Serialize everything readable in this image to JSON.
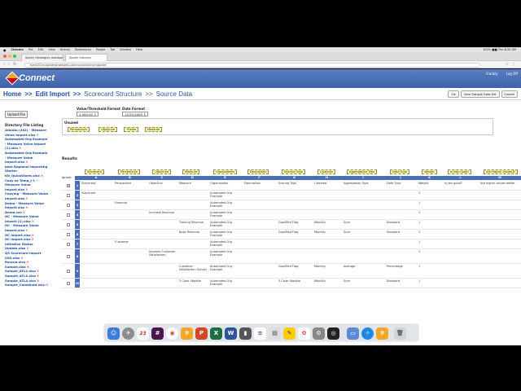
{
  "menubar": {
    "apple": "",
    "items": [
      "Chrome",
      "File",
      "Edit",
      "View",
      "History",
      "Bookmarks",
      "People",
      "Tab",
      "Window",
      "Help"
    ],
    "status": "100% ■■ Thu 8:20 AM"
  },
  "browser": {
    "tabs": [
      "Spider Strategies dashboard",
      "Spider Connect"
    ],
    "url": "hank33.us.spiderstrategies.com/connect/scyImporter"
  },
  "app": {
    "logo_text": "Connect",
    "header_links": [
      "Frankly",
      "Log Off"
    ],
    "breadcrumb": {
      "home": "Home",
      "sep1": ">>",
      "edit_import": "Edit Import",
      "sep2": ">>",
      "scorecard_structure": "Scorecard Structure",
      "sep3": ">>",
      "source_data": "Source Data"
    },
    "buttons": {
      "ok": "Ok",
      "view_sample": "View Sample Data Set",
      "cancel": "Cancel"
    }
  },
  "sidebar": {
    "upload_label": "Upload File",
    "dir_title": "Directory File Listing",
    "files": [
      "Atlanta (282) - Measure",
      "Value Import.xlsx",
      "Automated Org Example",
      "- Measure Value Import",
      "(1).xlsx",
      "Automated Org Example",
      "- Measure Value",
      "Import.xlsx",
      "bear Regional Importing",
      "Starter",
      "Kit_QuickStorm.xlsx",
      "Copy os Temp_J-1 -",
      "Measure Value",
      "Import.xlsx",
      "Copying - Measure Value",
      "Import.xlsx",
      "Demo - Measure Value",
      "Import.xlsx",
      "Demo.csv",
      "HC - Measure Value",
      "Import (1).xlsx",
      "HC - Measure Value",
      "Import.xlsx",
      "HC Import.xlsx",
      "HC Import.xlsx",
      "Initiative Status",
      "Update.xlsx",
      "QS Scorecard Import",
      "SSO.xlsx",
      "Rescue.xlsx",
      "Sample.xlsx",
      "Sample_ATL2.xlsx",
      "Sample_ATL3.xlsx",
      "Sample_ATL4.xlsx",
      "Sample_Combined.xlsx"
    ],
    "remove_marker": "✕"
  },
  "formats": {
    "value_label": "Value/Threshold Format",
    "value_selected": "1,000.00 ⇕",
    "date_label": "Date Format",
    "date_selected": "12/31/2009 ⇕"
  },
  "unused": {
    "label": "Unused",
    "chips": [
      "Perspective",
      "Objective",
      "Theme",
      "Measure"
    ]
  },
  "results": {
    "label": "Results",
    "ignore_label": "Ignore",
    "header_chips": [
      "Scorecard",
      "Perspective",
      "Objective",
      "Measure",
      "Organization",
      "Description",
      "Scoring Type",
      "Calendar",
      "Aggregation Type",
      "Data Type",
      "Weight",
      "Is Has Good?",
      "Are Higher Values B"
    ],
    "letters": [
      "A",
      "B",
      "C",
      "D",
      "E",
      "F",
      "G",
      "H",
      "I",
      "J",
      "K",
      "L",
      "M"
    ],
    "rows": [
      [
        "Scorecard",
        "Perspective",
        "Objective",
        "Measure",
        "Organization",
        "Description",
        "Scoring Type",
        "Calendar",
        "Aggregation Type",
        "Data Type",
        "Weight",
        "Is yes good?",
        "Are higher values better"
      ],
      [
        "Scorecard",
        "",
        "",
        "",
        "Automated Org Example",
        "",
        "",
        "",
        "",
        "",
        "1",
        "",
        ""
      ],
      [
        "",
        "Financial",
        "",
        "",
        "Automated Org Example",
        "",
        "",
        "",
        "",
        "",
        "1",
        "",
        ""
      ],
      [
        "",
        "",
        "Increase Revenue",
        "",
        "Automated Org Example",
        "",
        "",
        "",
        "",
        "",
        "1",
        "",
        ""
      ],
      [
        "",
        "",
        "",
        "Training Revenue",
        "Automated Org Example",
        "",
        "Goal/Red Flag",
        "Monthly",
        "Sum",
        "Standard",
        "1",
        "",
        ""
      ],
      [
        "",
        "",
        "",
        "Book Revenue",
        "Automated Org Example",
        "",
        "Goal/Red Flag",
        "Monthly",
        "Sum",
        "Standard",
        "1",
        "",
        ""
      ],
      [
        "",
        "Customer",
        "",
        "",
        "Automated Org Example",
        "",
        "",
        "",
        "",
        "",
        "1",
        "",
        ""
      ],
      [
        "",
        "",
        "Improve Customer Satisfaction",
        "",
        "Automated Org Example",
        "",
        "",
        "",
        "",
        "",
        "1",
        "",
        ""
      ],
      [
        "",
        "",
        "",
        "Customer Satisfaction Survey",
        "Automated Org Example",
        "",
        "Goal/Red Flag",
        "Monthly",
        "Average",
        "Percentage",
        "1",
        "",
        ""
      ],
      [
        "",
        "",
        "",
        "3 Color Stoplite",
        "Automated Org Example",
        "",
        "3 Color Stoplite",
        "Monthly",
        "Sum",
        "Standard",
        "1",
        "",
        ""
      ]
    ]
  }
}
